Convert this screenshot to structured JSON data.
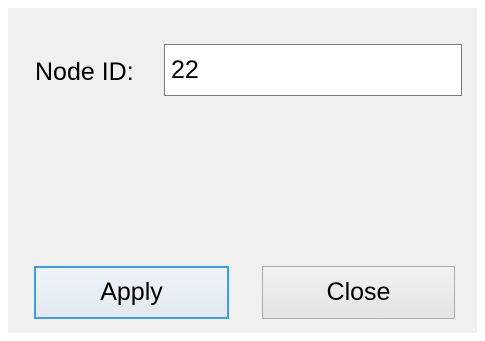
{
  "dialog": {
    "node_id_label": "Node ID:",
    "node_id_value": "22",
    "apply_label": "Apply",
    "close_label": "Close",
    "colors": {
      "background": "#f0f0f0",
      "focus_border": "#3c9ee6",
      "button_border": "#adadad"
    }
  }
}
